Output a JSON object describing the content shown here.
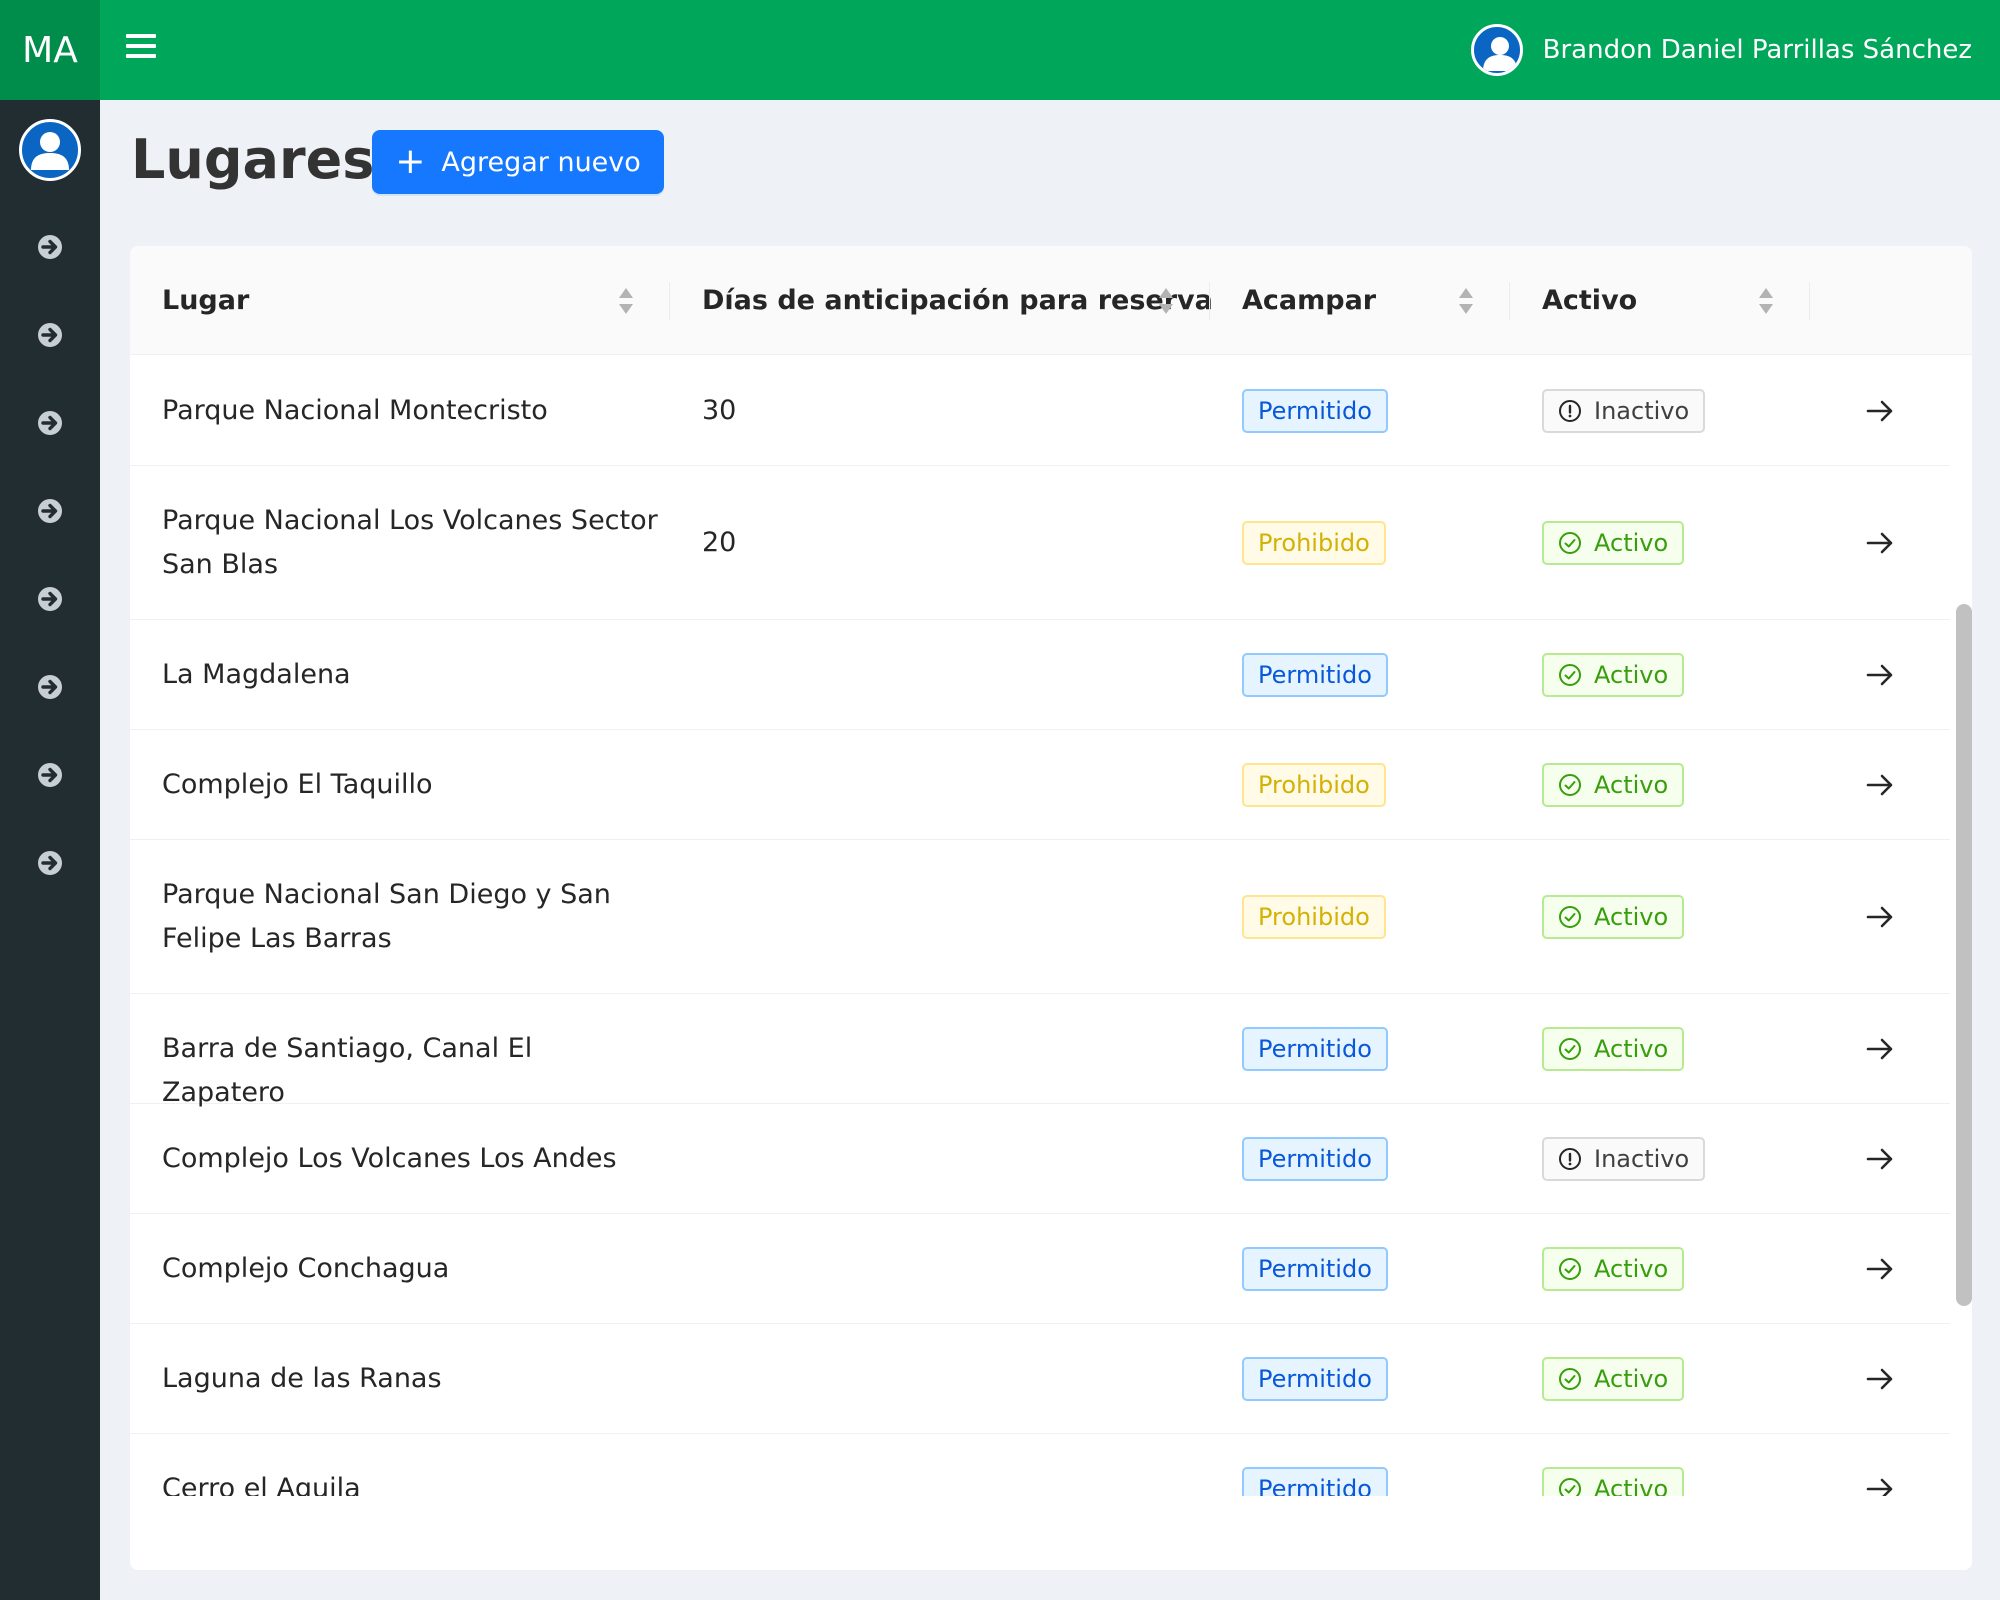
{
  "app": {
    "brand": "MA"
  },
  "header": {
    "user_name": "Brandon Daniel Parrillas Sánchez"
  },
  "page": {
    "title": "Lugares",
    "add_button_label": "Agregar nuevo"
  },
  "table": {
    "columns": [
      "Lugar",
      "Días de anticipación para reserva",
      "Acampar",
      "Activo"
    ],
    "rows": [
      {
        "lugar": "Parque Nacional Montecristo",
        "dias": "30",
        "acampar": "Permitido",
        "activo": "Inactivo"
      },
      {
        "lugar": "Parque Nacional Los Volcanes Sector San Blas",
        "dias": "20",
        "acampar": "Prohibido",
        "activo": "Activo"
      },
      {
        "lugar": "La Magdalena",
        "dias": "",
        "acampar": "Permitido",
        "activo": "Activo"
      },
      {
        "lugar": "Complejo El Taquillo",
        "dias": "",
        "acampar": "Prohibido",
        "activo": "Activo"
      },
      {
        "lugar": "Parque Nacional San Diego y San Felipe Las Barras",
        "dias": "",
        "acampar": "Prohibido",
        "activo": "Activo"
      },
      {
        "lugar": "Barra de Santiago, Canal El Zapatero",
        "dias": "",
        "acampar": "Permitido",
        "activo": "Activo"
      },
      {
        "lugar": "Complejo Los Volcanes Los Andes",
        "dias": "",
        "acampar": "Permitido",
        "activo": "Inactivo"
      },
      {
        "lugar": "Complejo Conchagua",
        "dias": "",
        "acampar": "Permitido",
        "activo": "Activo"
      },
      {
        "lugar": "Laguna de las Ranas",
        "dias": "",
        "acampar": "Permitido",
        "activo": "Activo"
      },
      {
        "lugar": "Cerro el Aguila",
        "dias": "",
        "acampar": "Permitido",
        "activo": "Activo"
      }
    ]
  },
  "colors": {
    "header_green": "#00a65a",
    "brand_green": "#008d4c",
    "sidebar": "#222d32",
    "primary_button": "#1677ff",
    "tag_permitido": "#0958d9",
    "tag_prohibido": "#d4b106",
    "tag_activo": "#389e0d"
  },
  "icons": {
    "menu": "hamburger-icon",
    "user": "user-avatar-icon",
    "sidebar_item": "arrow-circle-right-icon",
    "sort": "sort-icon",
    "row_action": "arrow-right-icon",
    "status_active": "check-circle-icon",
    "status_inactive": "exclamation-circle-icon"
  }
}
